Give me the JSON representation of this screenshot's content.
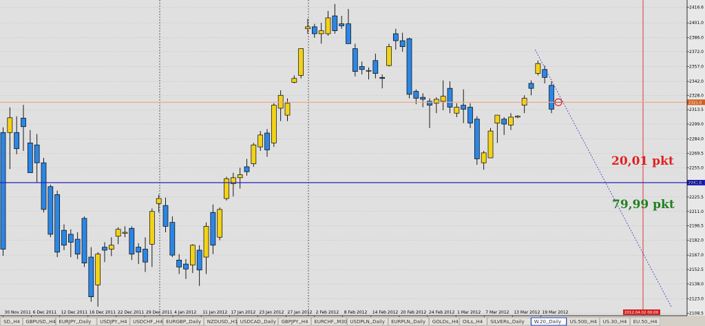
{
  "chart_data": {
    "type": "candlestick",
    "symbol": "W.20",
    "timeframe": "Daily",
    "ylim": [
      2106,
      2424
    ],
    "y_ticks": [
      2416.6,
      2401.0,
      2386.0,
      2372.0,
      2357.0,
      2342.0,
      2328.0,
      2313.5,
      2299.0,
      2284.0,
      2269.5,
      2255.0,
      2240.0,
      2225.5,
      2211.0,
      2196.5,
      2182.0,
      2167.0,
      2152.5,
      2138.0,
      2123.0,
      2108.5
    ],
    "x_ticks": [
      "30 Nov 2011",
      "6 Dec 2011",
      "12 Dec 2011",
      "16 Dec 2011",
      "22 Dec 2011",
      "29 Dec 2011",
      "4 Jan 2012",
      "11 Jan 2012",
      "17 Jan 2012",
      "23 Jan 2012",
      "27 Jan 2012",
      "2 Feb 2012",
      "8 Feb 2012",
      "14 Feb 2012",
      "20 Feb 2012",
      "24 Feb 2012",
      "1 Mar 2012",
      "7 Mar 2012",
      "13 Mar 2012",
      "19 Mar 2012"
    ],
    "candles": [
      {
        "o": 2290.5,
        "h": 2295.7,
        "l": 2166.2,
        "c": 2173.0
      },
      {
        "o": 2290.5,
        "h": 2315.9,
        "l": 2253.7,
        "c": 2305.4
      },
      {
        "o": 2290.5,
        "h": 2306.8,
        "l": 2268.6,
        "c": 2274.2
      },
      {
        "o": 2305.0,
        "h": 2318.4,
        "l": 2272.0,
        "c": 2296.4
      },
      {
        "o": 2280.0,
        "h": 2293.0,
        "l": 2250.0,
        "c": 2250.0
      },
      {
        "o": 2278.0,
        "h": 2289.0,
        "l": 2240.0,
        "c": 2260.0
      },
      {
        "o": 2260.0,
        "h": 2265.0,
        "l": 2210.0,
        "c": 2213.0
      },
      {
        "o": 2236.0,
        "h": 2238.0,
        "l": 2185.0,
        "c": 2188.0
      },
      {
        "o": 2228.0,
        "h": 2232.0,
        "l": 2165.0,
        "c": 2170.0
      },
      {
        "o": 2192.0,
        "h": 2198.0,
        "l": 2172.0,
        "c": 2177.0
      },
      {
        "o": 2188.0,
        "h": 2193.0,
        "l": 2165.0,
        "c": 2180.0
      },
      {
        "o": 2183.0,
        "h": 2190.0,
        "l": 2163.0,
        "c": 2168.0
      },
      {
        "o": 2204.0,
        "h": 2206.0,
        "l": 2155.0,
        "c": 2159.0
      },
      {
        "o": 2165.0,
        "h": 2175.0,
        "l": 2120.0,
        "c": 2125.0
      },
      {
        "o": 2137.0,
        "h": 2170.0,
        "l": 2115.0,
        "c": 2168.0
      },
      {
        "o": 2175.0,
        "h": 2180.0,
        "l": 2160.0,
        "c": 2172.0
      },
      {
        "o": 2173.0,
        "h": 2185.0,
        "l": 2166.0,
        "c": 2177.0
      },
      {
        "o": 2186.0,
        "h": 2195.0,
        "l": 2178.0,
        "c": 2193.0
      },
      {
        "o": 2189.0,
        "h": 2196.0,
        "l": 2185.0,
        "c": 2190.0
      },
      {
        "o": 2194.0,
        "h": 2196.0,
        "l": 2162.0,
        "c": 2168.0
      },
      {
        "o": 2175.0,
        "h": 2179.0,
        "l": 2158.0,
        "c": 2170.0
      },
      {
        "o": 2173.0,
        "h": 2185.0,
        "l": 2150.0,
        "c": 2160.0
      },
      {
        "o": 2178.0,
        "h": 2214.0,
        "l": 2155.0,
        "c": 2211.0
      },
      {
        "o": 2219.0,
        "h": 2228.0,
        "l": 2210.0,
        "c": 2224.0
      },
      {
        "o": 2217.0,
        "h": 2225.0,
        "l": 2190.0,
        "c": 2196.0
      },
      {
        "o": 2200.0,
        "h": 2206.0,
        "l": 2165.0,
        "c": 2167.0
      },
      {
        "o": 2162.0,
        "h": 2168.0,
        "l": 2148.0,
        "c": 2155.0
      },
      {
        "o": 2158.0,
        "h": 2163.0,
        "l": 2143.0,
        "c": 2153.0
      },
      {
        "o": 2157.0,
        "h": 2178.0,
        "l": 2149.0,
        "c": 2177.0
      },
      {
        "o": 2172.0,
        "h": 2177.0,
        "l": 2136.0,
        "c": 2152.0
      },
      {
        "o": 2165.0,
        "h": 2200.0,
        "l": 2148.0,
        "c": 2196.0
      },
      {
        "o": 2210.0,
        "h": 2218.0,
        "l": 2168.0,
        "c": 2177.0
      },
      {
        "o": 2185.0,
        "h": 2215.0,
        "l": 2182.0,
        "c": 2213.0
      },
      {
        "o": 2224.0,
        "h": 2246.0,
        "l": 2222.0,
        "c": 2244.0
      },
      {
        "o": 2239.0,
        "h": 2250.0,
        "l": 2226.0,
        "c": 2245.0
      },
      {
        "o": 2245.0,
        "h": 2255.0,
        "l": 2234.0,
        "c": 2248.0
      },
      {
        "o": 2256.0,
        "h": 2264.0,
        "l": 2247.0,
        "c": 2251.0
      },
      {
        "o": 2259.0,
        "h": 2280.0,
        "l": 2256.0,
        "c": 2278.0
      },
      {
        "o": 2276.0,
        "h": 2292.0,
        "l": 2272.0,
        "c": 2288.0
      },
      {
        "o": 2290.0,
        "h": 2294.0,
        "l": 2266.0,
        "c": 2273.0
      },
      {
        "o": 2280.0,
        "h": 2320.0,
        "l": 2276.0,
        "c": 2318.0
      },
      {
        "o": 2315.0,
        "h": 2333.0,
        "l": 2302.0,
        "c": 2328.0
      },
      {
        "o": 2308.0,
        "h": 2325.0,
        "l": 2302.0,
        "c": 2320.0
      },
      {
        "o": 2341.0,
        "h": 2348.0,
        "l": 2340.0,
        "c": 2345.0
      },
      {
        "o": 2348.0,
        "h": 2375.0,
        "l": 2345.0,
        "c": 2375.0
      },
      {
        "o": 2395.0,
        "h": 2405.0,
        "l": 2390.0,
        "c": 2397.0
      },
      {
        "o": 2397.0,
        "h": 2400.0,
        "l": 2386.0,
        "c": 2390.0
      },
      {
        "o": 2390.0,
        "h": 2401.0,
        "l": 2380.0,
        "c": 2393.0
      },
      {
        "o": 2390.0,
        "h": 2413.0,
        "l": 2388.0,
        "c": 2406.0
      },
      {
        "o": 2408.0,
        "h": 2420.0,
        "l": 2390.0,
        "c": 2393.0
      },
      {
        "o": 2400.0,
        "h": 2408.0,
        "l": 2395.0,
        "c": 2398.0
      },
      {
        "o": 2400.0,
        "h": 2415.0,
        "l": 2380.0,
        "c": 2380.0
      },
      {
        "o": 2375.0,
        "h": 2380.0,
        "l": 2347.0,
        "c": 2352.0
      },
      {
        "o": 2357.0,
        "h": 2362.0,
        "l": 2349.0,
        "c": 2354.0
      },
      {
        "o": 2353.0,
        "h": 2356.0,
        "l": 2344.0,
        "c": 2353.0
      },
      {
        "o": 2363.0,
        "h": 2370.0,
        "l": 2345.0,
        "c": 2350.0
      },
      {
        "o": 2346.0,
        "h": 2349.0,
        "l": 2335.0,
        "c": 2345.0
      },
      {
        "o": 2358.0,
        "h": 2380.0,
        "l": 2357.0,
        "c": 2377.0
      },
      {
        "o": 2390.0,
        "h": 2395.0,
        "l": 2374.0,
        "c": 2383.0
      },
      {
        "o": 2383.0,
        "h": 2391.0,
        "l": 2372.0,
        "c": 2377.0
      },
      {
        "o": 2385.0,
        "h": 2386.0,
        "l": 2325.0,
        "c": 2329.0
      },
      {
        "o": 2332.0,
        "h": 2334.0,
        "l": 2319.0,
        "c": 2325.0
      },
      {
        "o": 2326.0,
        "h": 2330.0,
        "l": 2316.0,
        "c": 2324.0
      },
      {
        "o": 2322.0,
        "h": 2325.0,
        "l": 2295.0,
        "c": 2318.0
      },
      {
        "o": 2320.0,
        "h": 2326.0,
        "l": 2310.0,
        "c": 2324.0
      },
      {
        "o": 2322.0,
        "h": 2343.0,
        "l": 2313.0,
        "c": 2327.0
      },
      {
        "o": 2335.0,
        "h": 2342.0,
        "l": 2310.0,
        "c": 2316.0
      },
      {
        "o": 2310.0,
        "h": 2320.0,
        "l": 2306.0,
        "c": 2316.0
      },
      {
        "o": 2318.0,
        "h": 2334.0,
        "l": 2300.0,
        "c": 2314.0
      },
      {
        "o": 2316.0,
        "h": 2320.0,
        "l": 2295.0,
        "c": 2300.0
      },
      {
        "o": 2304.0,
        "h": 2307.0,
        "l": 2258.0,
        "c": 2264.0
      },
      {
        "o": 2260.0,
        "h": 2272.0,
        "l": 2253.0,
        "c": 2270.0
      },
      {
        "o": 2265.0,
        "h": 2295.0,
        "l": 2265.0,
        "c": 2292.0
      },
      {
        "o": 2300.0,
        "h": 2308.0,
        "l": 2280.0,
        "c": 2308.0
      },
      {
        "o": 2304.0,
        "h": 2306.0,
        "l": 2288.0,
        "c": 2299.0
      },
      {
        "o": 2298.0,
        "h": 2310.0,
        "l": 2293.0,
        "c": 2306.0
      },
      {
        "o": 2306.0,
        "h": 2308.0,
        "l": 2305.0,
        "c": 2307.0
      },
      {
        "o": 2318.0,
        "h": 2328.0,
        "l": 2310.0,
        "c": 2325.0
      },
      {
        "o": 2340.0,
        "h": 2343.0,
        "l": 2328.0,
        "c": 2335.0
      },
      {
        "o": 2350.0,
        "h": 2363.0,
        "l": 2348.0,
        "c": 2360.0
      },
      {
        "o": 2354.0,
        "h": 2358.0,
        "l": 2340.0,
        "c": 2346.0
      },
      {
        "o": 2338.0,
        "h": 2342.0,
        "l": 2310.0,
        "c": 2314.0
      }
    ],
    "candle_x_start": 4.5,
    "candle_x_end": 801.0,
    "bull_color": "#f2d21a",
    "bear_color": "#2c86e4",
    "hlines": [
      {
        "value": 2321.0,
        "color": "#f0a888",
        "tag": "2321.0",
        "tag_color": "#d06020"
      },
      {
        "value": 2240.0,
        "color": "#2020c0",
        "tag": "2240.0",
        "tag_color": "#2020c0"
      }
    ],
    "vline_tag": "2012.04.02 00:00",
    "trendline": {
      "from": [
        2374.0
      ],
      "color": "#3030c0"
    },
    "annotations": [
      {
        "text": "20,01 pkt",
        "color": "#e02020"
      },
      {
        "text": "79,99 pkt",
        "color": "#208020"
      }
    ]
  },
  "tabs": [
    "SD,,H4",
    "GBPUSD,,H4",
    "EURJPY,,Daily",
    "USDJPY,,H4",
    "USDCHF,,H4",
    "EURGBP,,Daily",
    "NZDUSD,,H1",
    "USDCAD,,Daily",
    "GBPJPY,,H4",
    "EURCHF,,M30",
    "USDPLN,,Daily",
    "EURPLN,,Daily",
    "GOLDs,,H4",
    "OILs,,H4",
    "SILVERs,,Daily",
    "W.20,,Daily",
    "US.500,,H4",
    "US.30,,H4",
    "EU.50,,H4"
  ],
  "active_tab": 15,
  "colors": {
    "plot_bg": "#e0e0e0",
    "grid": "#a0a0a0"
  }
}
